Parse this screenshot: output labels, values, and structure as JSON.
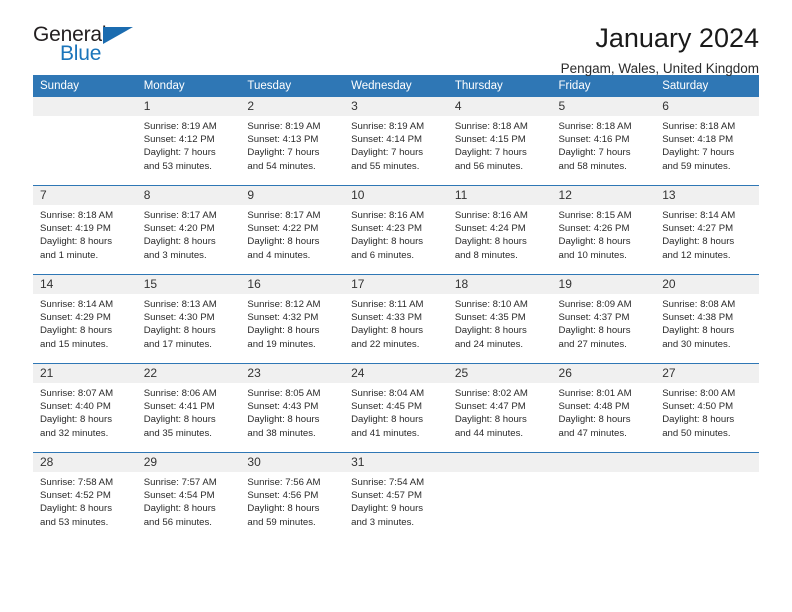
{
  "brand": {
    "name_part1": "General",
    "name_part2": "Blue"
  },
  "header": {
    "title": "January 2024",
    "location": "Pengam, Wales, United Kingdom"
  },
  "weekday_headers": [
    "Sunday",
    "Monday",
    "Tuesday",
    "Wednesday",
    "Thursday",
    "Friday",
    "Saturday"
  ],
  "colors": {
    "header_blue": "#2f77b5",
    "brand_blue": "#1b75bb",
    "daynum_gray": "#f0f0f0"
  },
  "weeks": [
    [
      {
        "day": "",
        "sunrise": "",
        "sunset": "",
        "daylight1": "",
        "daylight2": ""
      },
      {
        "day": "1",
        "sunrise": "Sunrise: 8:19 AM",
        "sunset": "Sunset: 4:12 PM",
        "daylight1": "Daylight: 7 hours",
        "daylight2": "and 53 minutes."
      },
      {
        "day": "2",
        "sunrise": "Sunrise: 8:19 AM",
        "sunset": "Sunset: 4:13 PM",
        "daylight1": "Daylight: 7 hours",
        "daylight2": "and 54 minutes."
      },
      {
        "day": "3",
        "sunrise": "Sunrise: 8:19 AM",
        "sunset": "Sunset: 4:14 PM",
        "daylight1": "Daylight: 7 hours",
        "daylight2": "and 55 minutes."
      },
      {
        "day": "4",
        "sunrise": "Sunrise: 8:18 AM",
        "sunset": "Sunset: 4:15 PM",
        "daylight1": "Daylight: 7 hours",
        "daylight2": "and 56 minutes."
      },
      {
        "day": "5",
        "sunrise": "Sunrise: 8:18 AM",
        "sunset": "Sunset: 4:16 PM",
        "daylight1": "Daylight: 7 hours",
        "daylight2": "and 58 minutes."
      },
      {
        "day": "6",
        "sunrise": "Sunrise: 8:18 AM",
        "sunset": "Sunset: 4:18 PM",
        "daylight1": "Daylight: 7 hours",
        "daylight2": "and 59 minutes."
      }
    ],
    [
      {
        "day": "7",
        "sunrise": "Sunrise: 8:18 AM",
        "sunset": "Sunset: 4:19 PM",
        "daylight1": "Daylight: 8 hours",
        "daylight2": "and 1 minute."
      },
      {
        "day": "8",
        "sunrise": "Sunrise: 8:17 AM",
        "sunset": "Sunset: 4:20 PM",
        "daylight1": "Daylight: 8 hours",
        "daylight2": "and 3 minutes."
      },
      {
        "day": "9",
        "sunrise": "Sunrise: 8:17 AM",
        "sunset": "Sunset: 4:22 PM",
        "daylight1": "Daylight: 8 hours",
        "daylight2": "and 4 minutes."
      },
      {
        "day": "10",
        "sunrise": "Sunrise: 8:16 AM",
        "sunset": "Sunset: 4:23 PM",
        "daylight1": "Daylight: 8 hours",
        "daylight2": "and 6 minutes."
      },
      {
        "day": "11",
        "sunrise": "Sunrise: 8:16 AM",
        "sunset": "Sunset: 4:24 PM",
        "daylight1": "Daylight: 8 hours",
        "daylight2": "and 8 minutes."
      },
      {
        "day": "12",
        "sunrise": "Sunrise: 8:15 AM",
        "sunset": "Sunset: 4:26 PM",
        "daylight1": "Daylight: 8 hours",
        "daylight2": "and 10 minutes."
      },
      {
        "day": "13",
        "sunrise": "Sunrise: 8:14 AM",
        "sunset": "Sunset: 4:27 PM",
        "daylight1": "Daylight: 8 hours",
        "daylight2": "and 12 minutes."
      }
    ],
    [
      {
        "day": "14",
        "sunrise": "Sunrise: 8:14 AM",
        "sunset": "Sunset: 4:29 PM",
        "daylight1": "Daylight: 8 hours",
        "daylight2": "and 15 minutes."
      },
      {
        "day": "15",
        "sunrise": "Sunrise: 8:13 AM",
        "sunset": "Sunset: 4:30 PM",
        "daylight1": "Daylight: 8 hours",
        "daylight2": "and 17 minutes."
      },
      {
        "day": "16",
        "sunrise": "Sunrise: 8:12 AM",
        "sunset": "Sunset: 4:32 PM",
        "daylight1": "Daylight: 8 hours",
        "daylight2": "and 19 minutes."
      },
      {
        "day": "17",
        "sunrise": "Sunrise: 8:11 AM",
        "sunset": "Sunset: 4:33 PM",
        "daylight1": "Daylight: 8 hours",
        "daylight2": "and 22 minutes."
      },
      {
        "day": "18",
        "sunrise": "Sunrise: 8:10 AM",
        "sunset": "Sunset: 4:35 PM",
        "daylight1": "Daylight: 8 hours",
        "daylight2": "and 24 minutes."
      },
      {
        "day": "19",
        "sunrise": "Sunrise: 8:09 AM",
        "sunset": "Sunset: 4:37 PM",
        "daylight1": "Daylight: 8 hours",
        "daylight2": "and 27 minutes."
      },
      {
        "day": "20",
        "sunrise": "Sunrise: 8:08 AM",
        "sunset": "Sunset: 4:38 PM",
        "daylight1": "Daylight: 8 hours",
        "daylight2": "and 30 minutes."
      }
    ],
    [
      {
        "day": "21",
        "sunrise": "Sunrise: 8:07 AM",
        "sunset": "Sunset: 4:40 PM",
        "daylight1": "Daylight: 8 hours",
        "daylight2": "and 32 minutes."
      },
      {
        "day": "22",
        "sunrise": "Sunrise: 8:06 AM",
        "sunset": "Sunset: 4:41 PM",
        "daylight1": "Daylight: 8 hours",
        "daylight2": "and 35 minutes."
      },
      {
        "day": "23",
        "sunrise": "Sunrise: 8:05 AM",
        "sunset": "Sunset: 4:43 PM",
        "daylight1": "Daylight: 8 hours",
        "daylight2": "and 38 minutes."
      },
      {
        "day": "24",
        "sunrise": "Sunrise: 8:04 AM",
        "sunset": "Sunset: 4:45 PM",
        "daylight1": "Daylight: 8 hours",
        "daylight2": "and 41 minutes."
      },
      {
        "day": "25",
        "sunrise": "Sunrise: 8:02 AM",
        "sunset": "Sunset: 4:47 PM",
        "daylight1": "Daylight: 8 hours",
        "daylight2": "and 44 minutes."
      },
      {
        "day": "26",
        "sunrise": "Sunrise: 8:01 AM",
        "sunset": "Sunset: 4:48 PM",
        "daylight1": "Daylight: 8 hours",
        "daylight2": "and 47 minutes."
      },
      {
        "day": "27",
        "sunrise": "Sunrise: 8:00 AM",
        "sunset": "Sunset: 4:50 PM",
        "daylight1": "Daylight: 8 hours",
        "daylight2": "and 50 minutes."
      }
    ],
    [
      {
        "day": "28",
        "sunrise": "Sunrise: 7:58 AM",
        "sunset": "Sunset: 4:52 PM",
        "daylight1": "Daylight: 8 hours",
        "daylight2": "and 53 minutes."
      },
      {
        "day": "29",
        "sunrise": "Sunrise: 7:57 AM",
        "sunset": "Sunset: 4:54 PM",
        "daylight1": "Daylight: 8 hours",
        "daylight2": "and 56 minutes."
      },
      {
        "day": "30",
        "sunrise": "Sunrise: 7:56 AM",
        "sunset": "Sunset: 4:56 PM",
        "daylight1": "Daylight: 8 hours",
        "daylight2": "and 59 minutes."
      },
      {
        "day": "31",
        "sunrise": "Sunrise: 7:54 AM",
        "sunset": "Sunset: 4:57 PM",
        "daylight1": "Daylight: 9 hours",
        "daylight2": "and 3 minutes."
      },
      {
        "day": "",
        "sunrise": "",
        "sunset": "",
        "daylight1": "",
        "daylight2": ""
      },
      {
        "day": "",
        "sunrise": "",
        "sunset": "",
        "daylight1": "",
        "daylight2": ""
      },
      {
        "day": "",
        "sunrise": "",
        "sunset": "",
        "daylight1": "",
        "daylight2": ""
      }
    ]
  ]
}
